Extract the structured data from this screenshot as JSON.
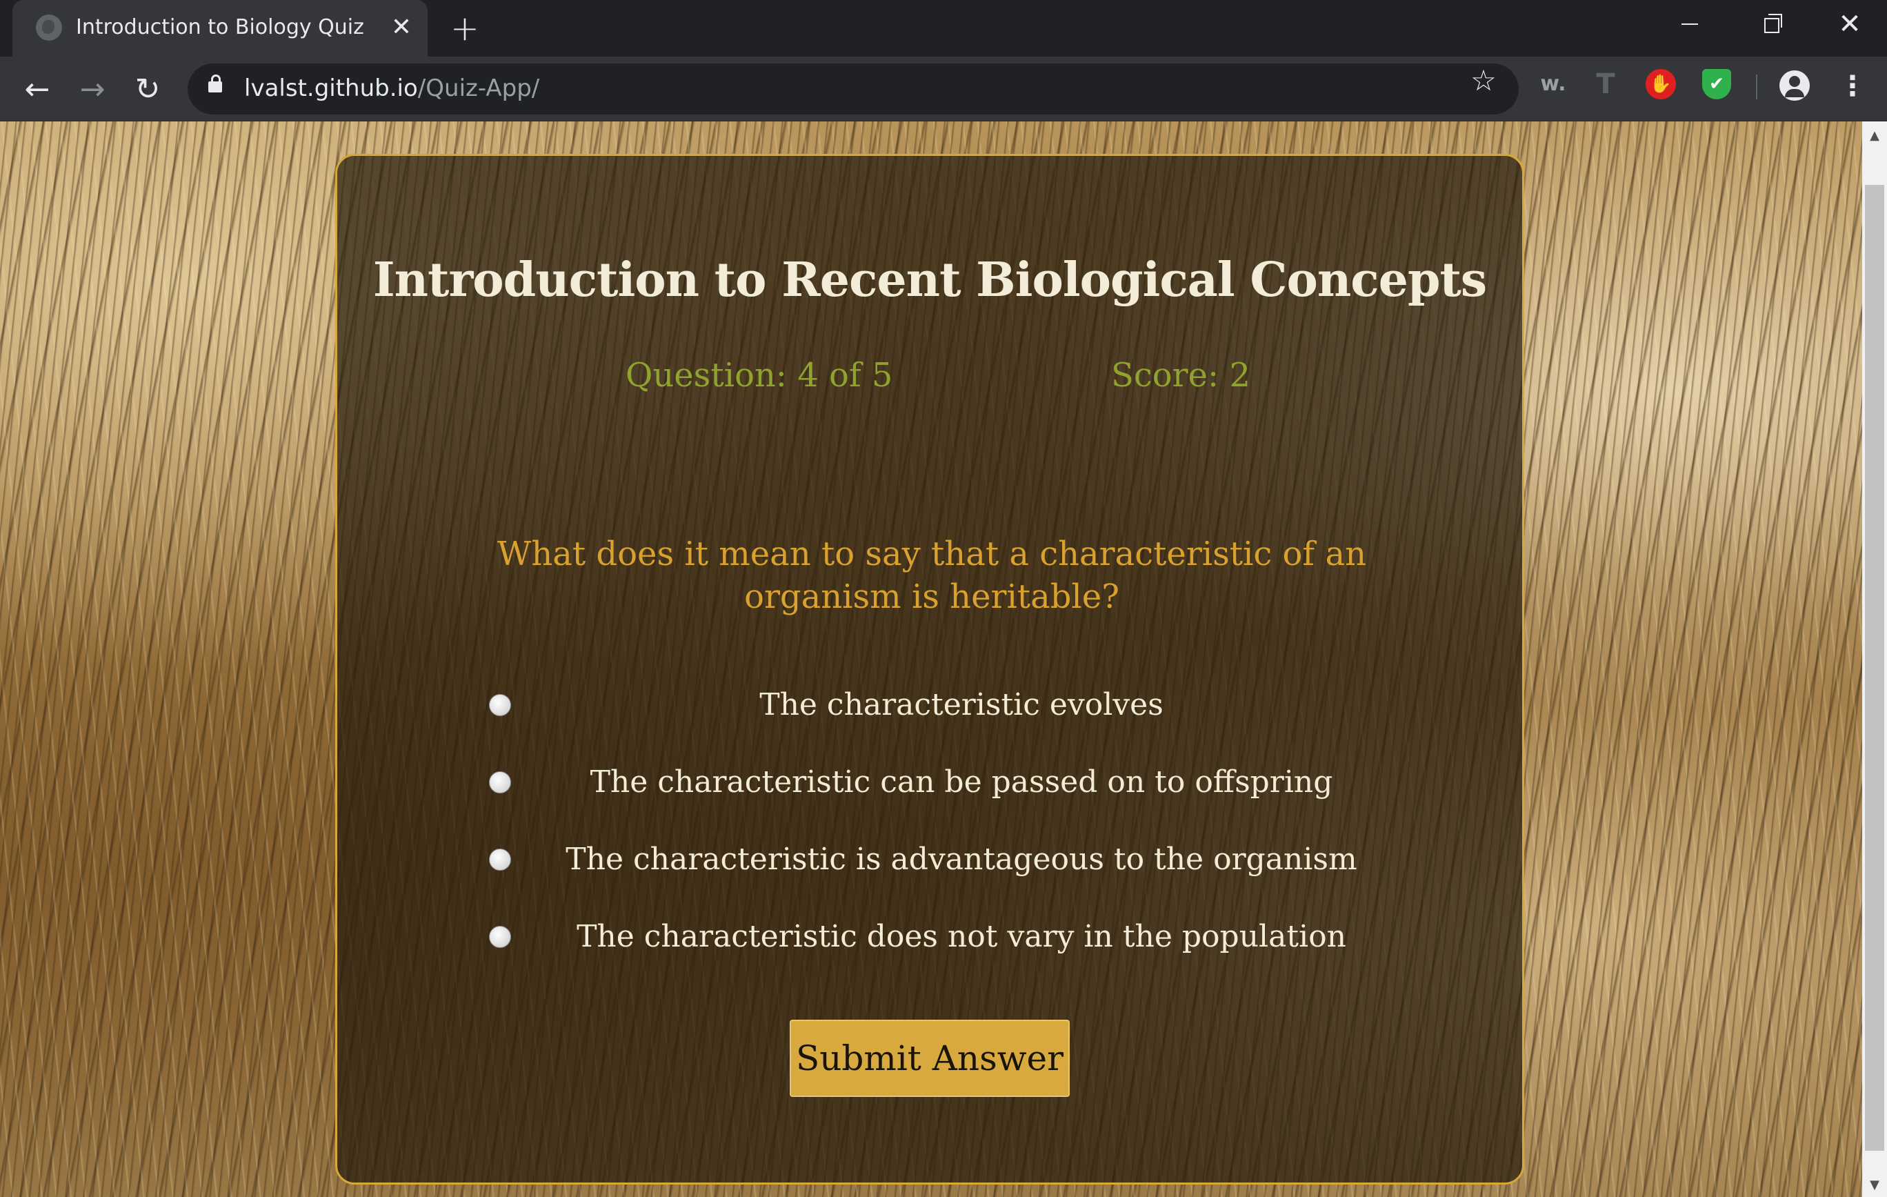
{
  "browser": {
    "tab_title": "Introduction to Biology Quiz",
    "tab_close": "✕",
    "new_tab": "+",
    "url_host": "lvalst.github.io",
    "url_path": "/Quiz-App/",
    "back": "←",
    "forward": "→",
    "reload": "↻",
    "star": "☆",
    "ext_w": "w.",
    "ext_t": "T",
    "ext_hand": "✋",
    "ext_shield": "✔",
    "menu": "⋮",
    "window_close": "✕"
  },
  "quiz": {
    "title": "Introduction to Recent Biological Concepts",
    "question_counter": "Question: 4 of 5",
    "score": "Score: 2",
    "question": "What does it mean to say that a characteristic of an organism is heritable?",
    "options": [
      "The characteristic evolves",
      "The characteristic can be passed on to offspring",
      "The characteristic is advantageous to the organism",
      "The characteristic does not vary in the population"
    ],
    "submit_label": "Submit Answer"
  },
  "colors": {
    "accent": "#d4a93a",
    "counter": "#8fa32e",
    "question": "#d9a12f",
    "button": "#d8a93f"
  },
  "icons": [
    "globe-icon",
    "close-icon",
    "plus-icon",
    "back-arrow-icon",
    "forward-arrow-icon",
    "reload-icon",
    "lock-icon",
    "star-icon",
    "profile-icon",
    "kebab-menu-icon"
  ]
}
